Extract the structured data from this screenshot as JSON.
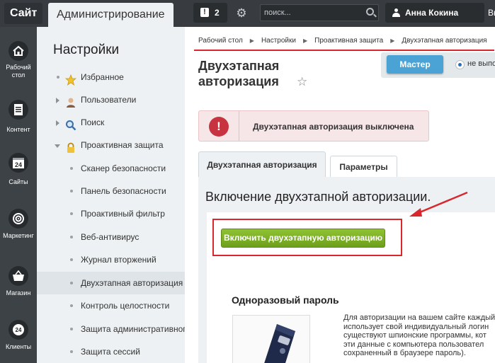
{
  "topbar": {
    "brand": "Сайт",
    "admin_tab": "Администрирование",
    "notifications_count": "2",
    "search_placeholder": "поиск...",
    "user_name": "Анна Кокина",
    "logout": "Выйти"
  },
  "leftnav": {
    "items": [
      {
        "label": "Рабочий стол",
        "icon": "home-icon"
      },
      {
        "label": "Контент",
        "icon": "document-icon"
      },
      {
        "label": "Сайты",
        "icon": "calendar-icon"
      },
      {
        "label": "Маркетинг",
        "icon": "target-icon"
      },
      {
        "label": "Магазин",
        "icon": "basket-icon"
      },
      {
        "label": "Клиенты",
        "icon": "clients-icon"
      }
    ],
    "sites_day": "24",
    "clients_badge": "24"
  },
  "settings": {
    "title": "Настройки",
    "items": [
      {
        "label": "Избранное",
        "icon": "star-icon"
      },
      {
        "label": "Пользователи",
        "icon": "user-icon"
      },
      {
        "label": "Поиск",
        "icon": "search-icon"
      },
      {
        "label": "Проактивная защита",
        "icon": "lock-icon"
      },
      {
        "label": "Сканер безопасности"
      },
      {
        "label": "Панель безопасности"
      },
      {
        "label": "Проактивный фильтр"
      },
      {
        "label": "Веб-антивирус"
      },
      {
        "label": "Журнал вторжений"
      },
      {
        "label": "Двухэтапная авторизация"
      },
      {
        "label": "Контроль целостности"
      },
      {
        "label": "Защита административного"
      },
      {
        "label": "Защита сессий"
      }
    ]
  },
  "main": {
    "breadcrumb": [
      "Рабочий стол",
      "Настройки",
      "Проактивная защита",
      "Двухэтапная авторизация"
    ],
    "title_line1": "Двухэтапная",
    "title_line2": "авторизация",
    "master_button": "Мастер",
    "radio_label": "не выполнялся",
    "alert_text": "Двухэтапная авторизация выключена",
    "tabs": [
      "Двухэтапная авторизация",
      "Параметры"
    ],
    "panel_title": "Включение двухэтапной авторизации.",
    "enable_button": "Включить двухэтапную авторизацию",
    "otp_title": "Одноразовый пароль",
    "otp_desc": [
      "Для авторизации на вашем сайте каждый",
      "использует свой индивидуальный логин",
      "существуют шпионские программы, кот",
      "эти данные с компьютера пользовател",
      "сохраненный в браузере пароль)."
    ]
  },
  "colors": {
    "topbar": "#383c40",
    "accent_red": "#d9272e",
    "master_blue": "#4aa3d4",
    "enable_green": "#7cb02a"
  }
}
